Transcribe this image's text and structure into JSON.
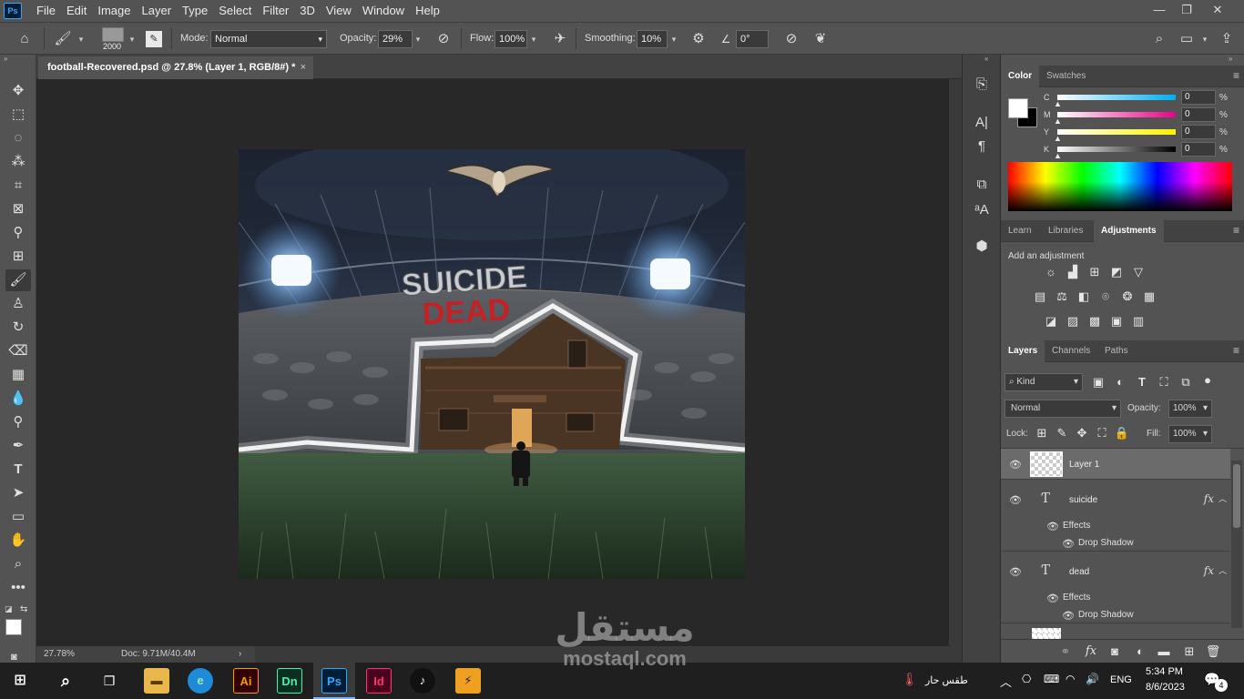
{
  "menubar": {
    "logo": "Ps",
    "items": [
      "File",
      "Edit",
      "Image",
      "Layer",
      "Type",
      "Select",
      "Filter",
      "3D",
      "View",
      "Window",
      "Help"
    ],
    "window_controls": [
      "—",
      "❐",
      "✕"
    ]
  },
  "options": {
    "brush_size": "2000",
    "mode_label": "Mode:",
    "mode_value": "Normal",
    "opacity_label": "Opacity:",
    "opacity_value": "29%",
    "flow_label": "Flow:",
    "flow_value": "100%",
    "smoothing_label": "Smoothing:",
    "smoothing_value": "10%",
    "angle_value": "0°"
  },
  "document": {
    "tab_title": "football-Recovered.psd @ 27.8% (Layer 1, RGB/8#) *",
    "close": "×",
    "zoom": "27.78%",
    "doc_size": "Doc: 9.71M/40.4M",
    "artwork_text_top": "SUICIDE",
    "artwork_text_bottom": "DEAD"
  },
  "color_panel": {
    "tabs": [
      "Color",
      "Swatches"
    ],
    "channels": [
      {
        "label": "C",
        "value": "0",
        "unit": "%",
        "gradient": "#ffffff,#00aeef"
      },
      {
        "label": "M",
        "value": "0",
        "unit": "%",
        "gradient": "#ffffff,#ec008c"
      },
      {
        "label": "Y",
        "value": "0",
        "unit": "%",
        "gradient": "#ffffff,#fff200"
      },
      {
        "label": "K",
        "value": "0",
        "unit": "%",
        "gradient": "#ffffff,#000000"
      }
    ]
  },
  "adjust_panel": {
    "tabs": [
      "Learn",
      "Libraries",
      "Adjustments"
    ],
    "add_label": "Add an adjustment"
  },
  "layers_panel": {
    "tabs": [
      "Layers",
      "Channels",
      "Paths"
    ],
    "filter_kind": "Kind",
    "blend_mode": "Normal",
    "opacity_label": "Opacity:",
    "opacity_value": "100%",
    "lock_label": "Lock:",
    "fill_label": "Fill:",
    "fill_value": "100%",
    "layers": [
      {
        "name": "Layer 1"
      },
      {
        "name": "suicide",
        "effects": "Effects",
        "effect": "Drop Shadow"
      },
      {
        "name": "dead",
        "effects": "Effects",
        "effect": "Drop Shadow"
      }
    ]
  },
  "taskbar": {
    "apps": [
      "Ai",
      "Dn",
      "Ps",
      "Id"
    ],
    "weather": "طقس حار",
    "language": "ENG",
    "time": "5:34 PM",
    "date": "8/6/2023",
    "notifications": "4"
  },
  "watermark": {
    "arabic": "مستقل",
    "latin": "mostaql.com"
  }
}
